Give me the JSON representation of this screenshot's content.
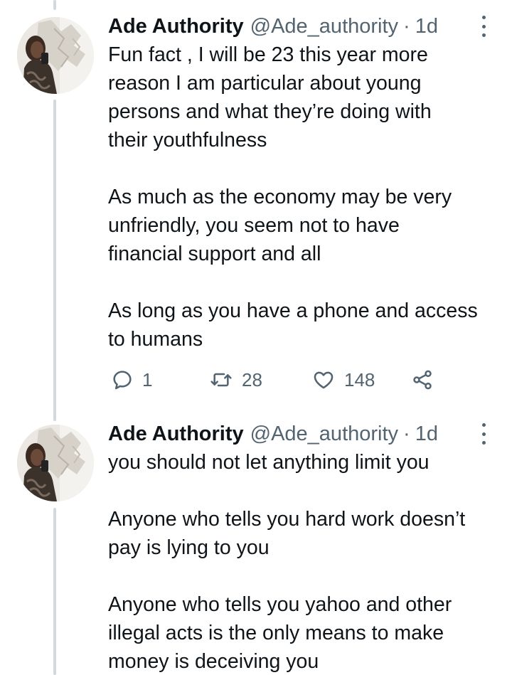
{
  "thread": {
    "tweets": [
      {
        "author_name": "Ade Authority",
        "author_handle": "@Ade_authority",
        "separator": "·",
        "time": "1d",
        "paragraphs": [
          [
            "Fun fact , I will be 23 this year more",
            "reason I am particular about young",
            "persons and what they’re doing with",
            "their youthfulness"
          ],
          [
            "As much as the economy may be very",
            "unfriendly, you seem not to have",
            "financial support and all"
          ],
          [
            "As long as you have a phone and access",
            "to humans"
          ]
        ],
        "stats": {
          "replies": "1",
          "retweets": "28",
          "likes": "148"
        }
      },
      {
        "author_name": "Ade Authority",
        "author_handle": "@Ade_authority",
        "separator": "·",
        "time": "1d",
        "paragraphs": [
          [
            "you should not let anything limit you"
          ],
          [
            "Anyone who tells you hard work doesn’t",
            "pay is lying to you"
          ],
          [
            "Anyone who tells you yahoo and other",
            "illegal acts is the only means to make",
            "money is deceiving you"
          ]
        ]
      }
    ]
  },
  "icons": {
    "reply": "reply-icon",
    "retweet": "retweet-icon",
    "like": "heart-icon",
    "share": "share-icon",
    "more": "more-options-icon"
  },
  "colors": {
    "text_primary": "#0f1419",
    "text_secondary": "#536471",
    "thread_line": "#cfd9de"
  }
}
